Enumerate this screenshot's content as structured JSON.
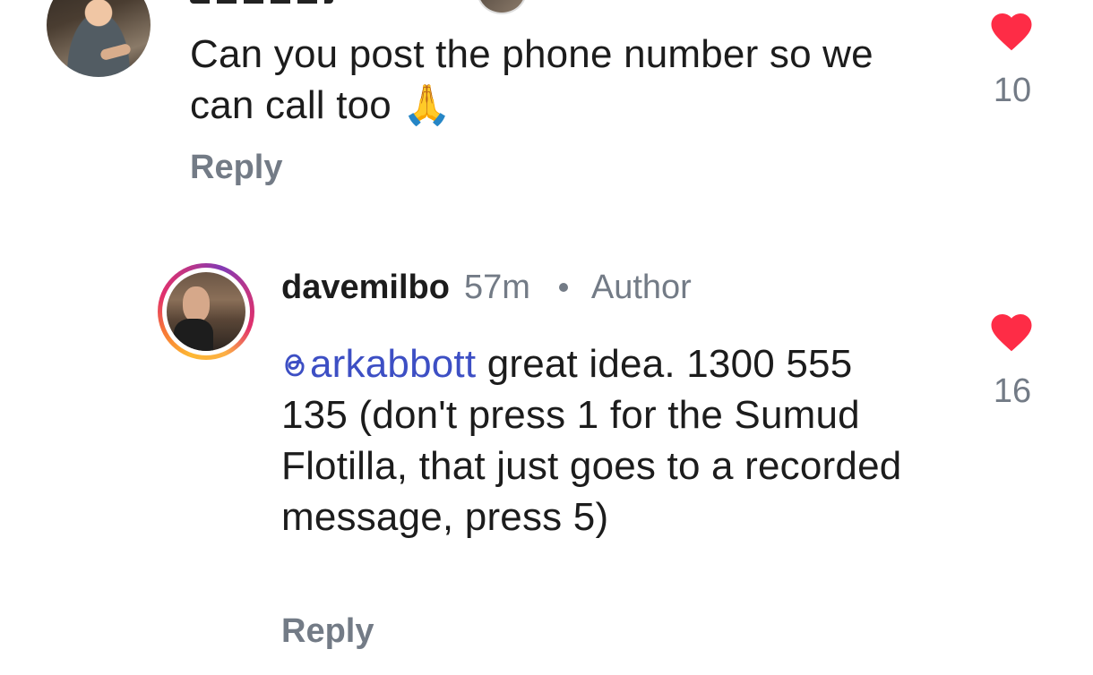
{
  "comments": [
    {
      "text": "Can you post the phone number so we can call too 🙏",
      "reply_label": "Reply",
      "like_count": "10",
      "liked": true
    },
    {
      "username": "davemilbo",
      "time": "57m",
      "badge": "Author",
      "mention": "arkabbott",
      "text": " great idea. 1300 555 135 (don't press 1 for the Sumud Flotilla, that just goes to a recorded message, press 5)",
      "reply_label": "Reply",
      "like_count": "16",
      "liked": true
    }
  ],
  "colors": {
    "like": "#fe2c46",
    "mention": "#3d4fc4",
    "secondary_text": "#737b86"
  },
  "icons": {
    "like": "heart-icon",
    "mention": "threads-at-icon"
  }
}
